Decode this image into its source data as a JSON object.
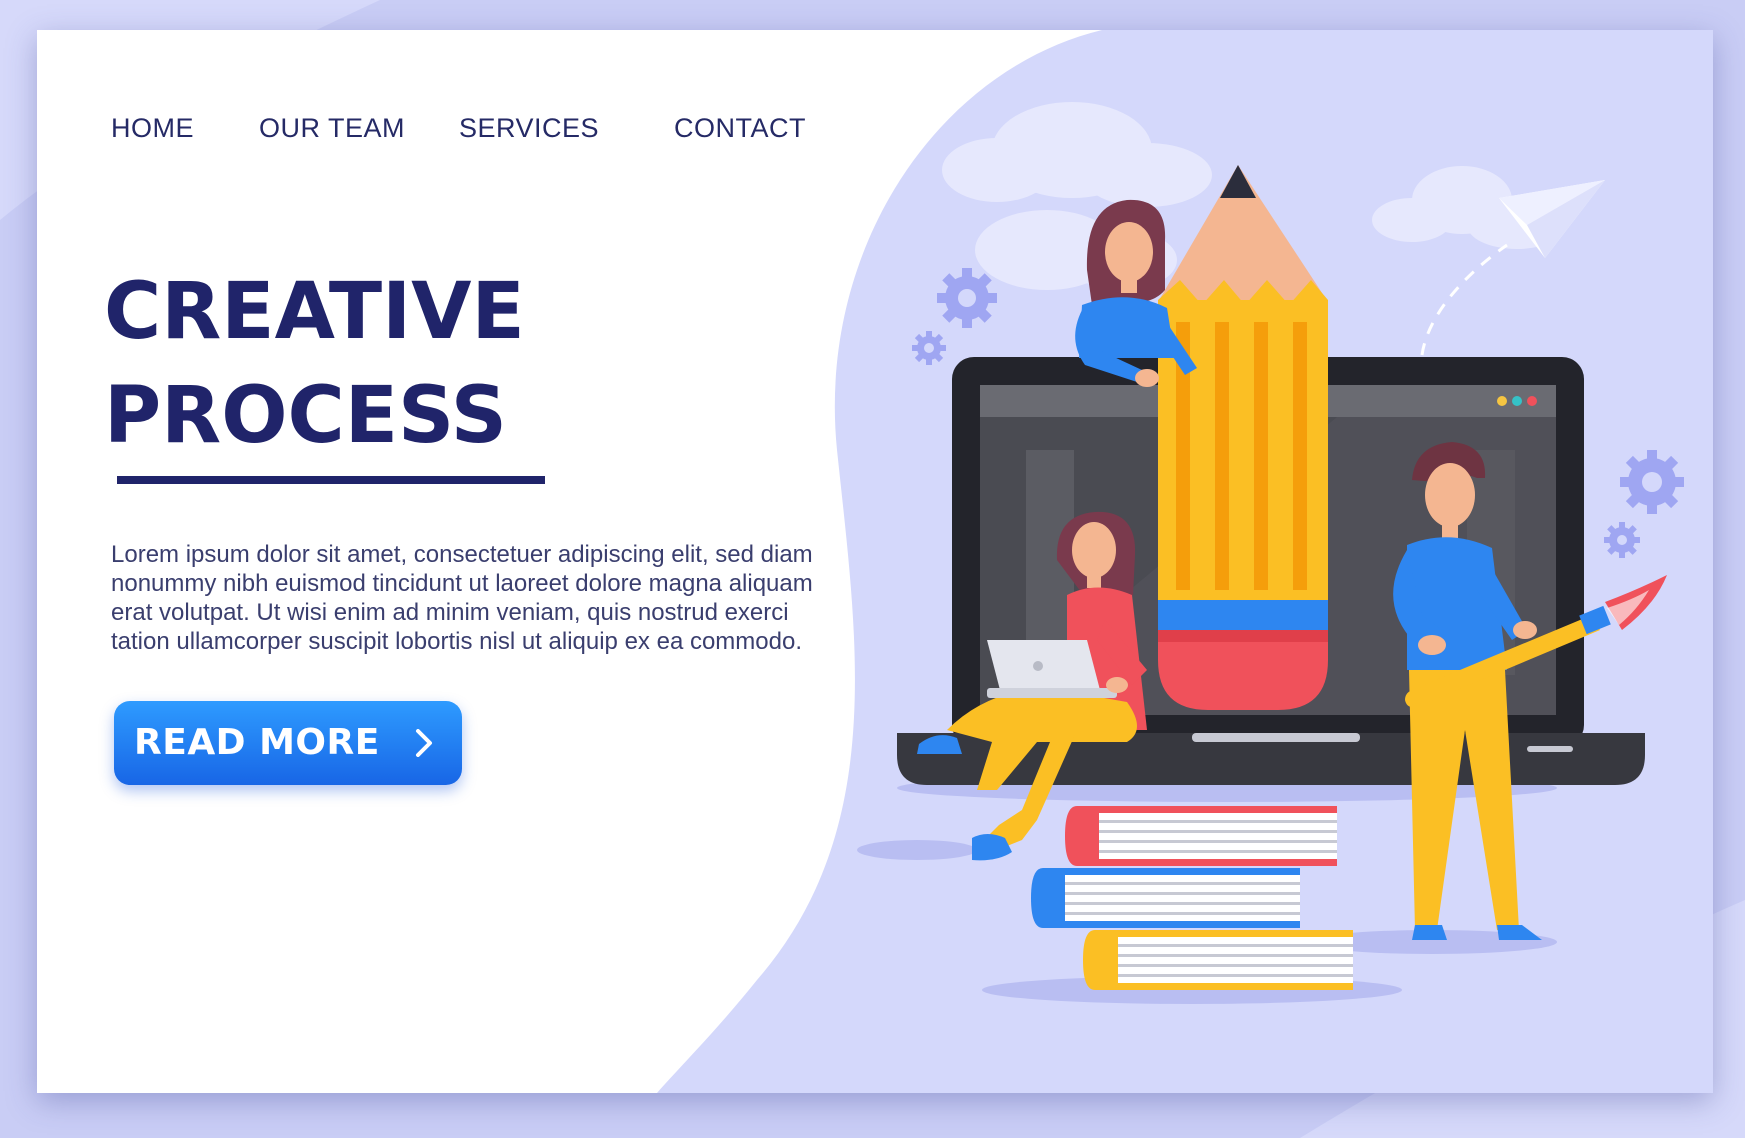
{
  "nav": {
    "items": [
      {
        "label": "HOME"
      },
      {
        "label": "OUR TEAM"
      },
      {
        "label": "SERVICES"
      },
      {
        "label": "CONTACT"
      }
    ]
  },
  "hero": {
    "title_line1": "CREATIVE",
    "title_line2": "PROCESS",
    "body": "Lorem ipsum dolor sit amet, consectetuer adipiscing elit, sed diam nonummy nibh euismod tincidunt ut laoreet dolore magna aliquam erat volutpat. Ut wisi enim ad minim veniam, quis nostrud exerci tation ullamcorper suscipit lobortis nisl ut aliquip ex ea commodo.",
    "cta_label": "READ MORE"
  },
  "illustration": {
    "icons": [
      "cloud-icon",
      "paper-plane-icon",
      "gear-icon",
      "laptop-icon",
      "pencil-icon",
      "book-icon",
      "paintbrush-icon"
    ]
  },
  "colors": {
    "page_bg": "#c9cdf5",
    "card_bg": "#ffffff",
    "illustration_bg": "#d4d8fb",
    "title": "#20246a",
    "nav_text": "#252a66",
    "body_text": "#3a3e6e",
    "button_top": "#2e9bff",
    "button_bottom": "#1866e6",
    "pencil_yellow": "#fbbf24",
    "eraser_red": "#f0515b",
    "laptop_dark": "#2e2f36"
  }
}
